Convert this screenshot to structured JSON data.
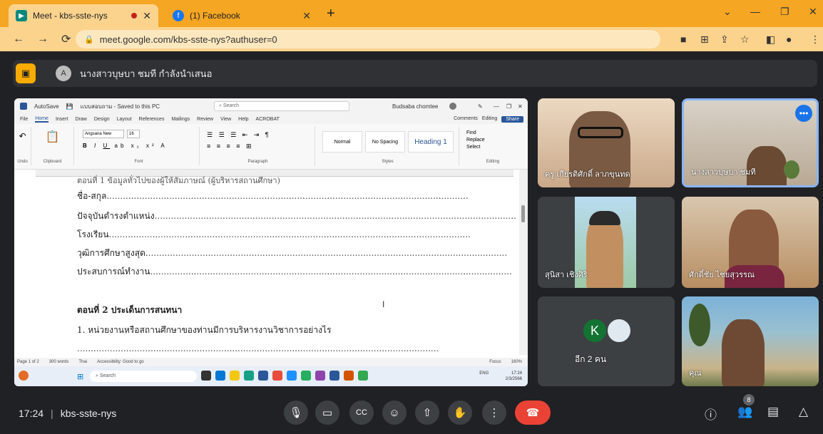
{
  "browser": {
    "tabs": [
      {
        "title": "Meet - kbs-sste-nys",
        "active": true
      },
      {
        "title": "(1) Facebook",
        "active": false
      }
    ],
    "url": "meet.google.com/kbs-sste-nys?authuser=0"
  },
  "presentation_bar": {
    "presenter_text": "นางสาวบุษบา ชมที กำลังนำเสนอ",
    "avatar_letter": "A"
  },
  "shared_screen": {
    "word": {
      "autosave": "AutoSave",
      "doc_title": "แบบสอบถาม - Saved to this PC",
      "search": "Search",
      "user": "Budsaba chomtee",
      "menu": [
        "File",
        "Home",
        "Insert",
        "Draw",
        "Design",
        "Layout",
        "References",
        "Mailings",
        "Review",
        "View",
        "Help",
        "ACROBAT"
      ],
      "menu_selected": "Home",
      "comments": "Comments",
      "editing": "Editing",
      "share": "Share",
      "font_name": "Angsana New",
      "font_size": "16",
      "styles": [
        "Normal",
        "No Spacing",
        "Heading 1"
      ],
      "groups": [
        "Undo",
        "Clipboard",
        "Font",
        "Paragraph",
        "Styles",
        "Editing"
      ],
      "find": "Find",
      "replace": "Replace",
      "select": "Select",
      "status": {
        "page": "Page 1 of 2",
        "words": "300 words",
        "lang": "Thai",
        "accessibility": "Accessibility: Good to go",
        "focus": "Focus",
        "zoom": "160%"
      }
    },
    "document_lines": {
      "line0": "ตอนที่ 1 ข้อมูลทั่วไปของผู้ให้สัมภาษณ์ (ผู้บริหารสถานศึกษา)",
      "line1": "ชื่อ-สกุล",
      "line2": "ปัจจุบันดำรงตำแหน่ง",
      "line3": "โรงเรียน",
      "line4": "วุฒิการศึกษาสูงสุด",
      "line5": "ประสบการณ์ทำงาน",
      "section2": "ตอนที่ 2 ประเด็นการสนทนา",
      "q1": "1. หน่วยงานหรือสถานศึกษาของท่านมีการบริหารงานวิชาการอย่างไร",
      "dots": "....................................................................................................................................."
    },
    "taskbar": {
      "search": "Search",
      "lang": "ENG",
      "time": "17:24",
      "date": "2/3/2566"
    }
  },
  "participants": [
    {
      "name": "ครู เกียรติศักดิ์ ลาภขุนทด"
    },
    {
      "name": "นางสาวบุษบา ชมที"
    },
    {
      "name": "สุนิสา เชิงศิริ"
    },
    {
      "name": "ศักดิ์ชัย ไชยสุวรรณ"
    },
    {
      "name": "อีก 2 คน",
      "avatar_letter": "K"
    },
    {
      "name": "คุณ"
    }
  ],
  "bottom_bar": {
    "time": "17:24",
    "meeting_code": "kbs-sste-nys",
    "participant_count": "8"
  },
  "colors": {
    "accent": "#1a73e8",
    "end_call": "#ea4335",
    "browser_frame": "#f5a623",
    "presenting": "#f9ab00"
  }
}
